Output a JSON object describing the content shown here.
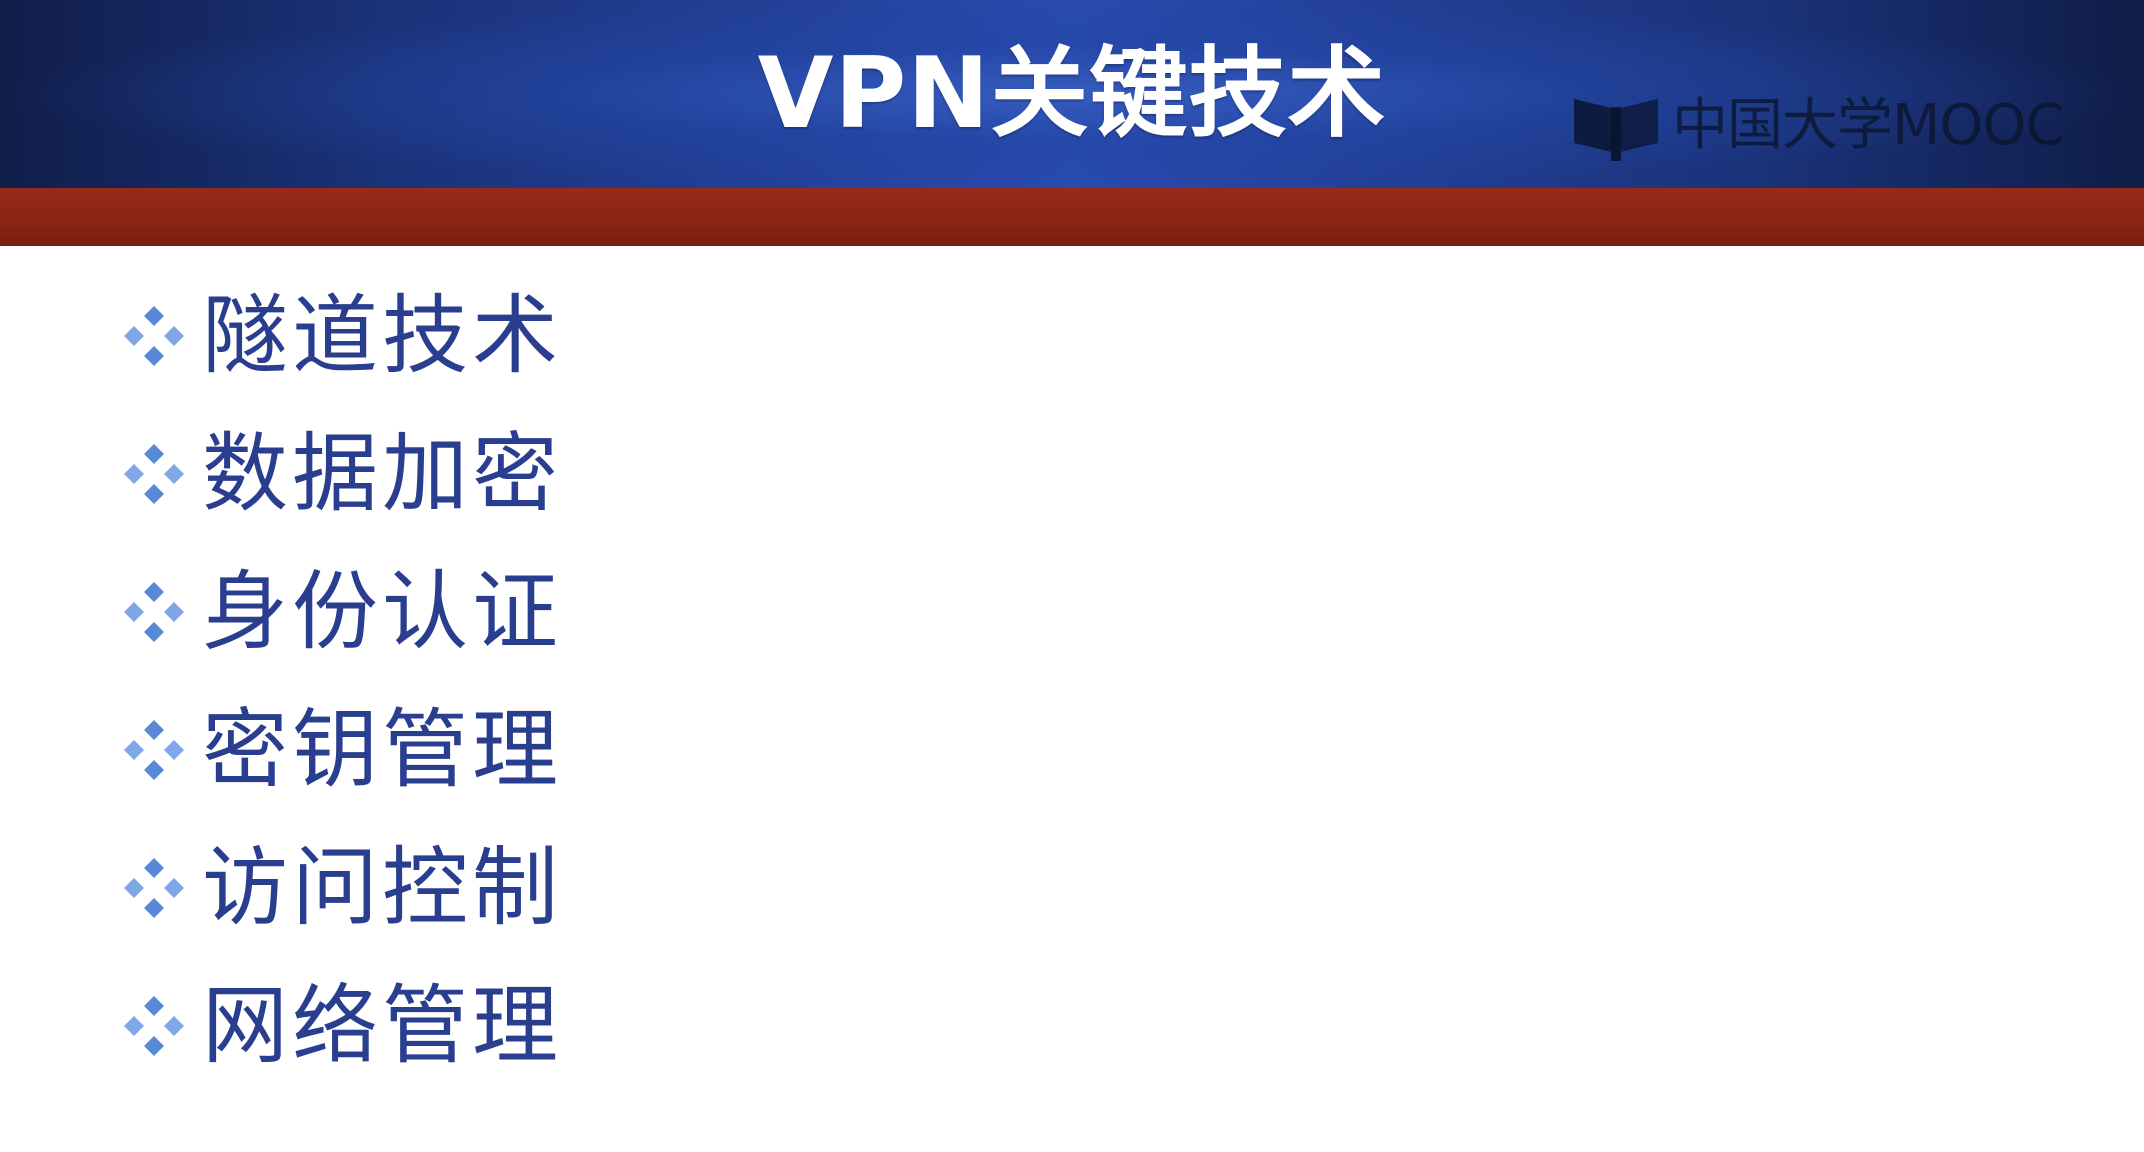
{
  "slide": {
    "title": "VPN关键技术",
    "watermark": "中国大学MOOC",
    "items": [
      {
        "label": "隧道技术"
      },
      {
        "label": "数据加密"
      },
      {
        "label": "身份认证"
      },
      {
        "label": "密钥管理"
      },
      {
        "label": "访问控制"
      },
      {
        "label": "网络管理"
      }
    ],
    "colors": {
      "header_blue": "#2a4bb0",
      "accent_red": "#8b2514",
      "text_blue": "#2a3e8f",
      "bullet_blue": "#5a88d8"
    },
    "icons": {
      "bullet": "four-diamond-bullet-icon",
      "logo": "book-logo-icon"
    }
  }
}
